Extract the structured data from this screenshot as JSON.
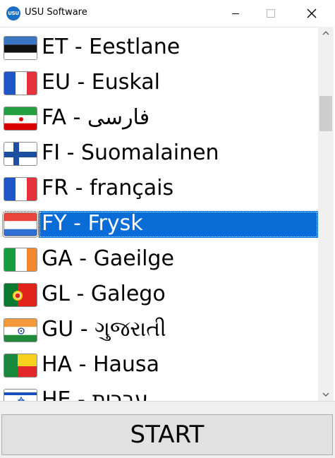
{
  "window": {
    "title": "USU Software",
    "app_icon_text": "USU"
  },
  "languages": [
    {
      "label": "ET - Eestlane",
      "flag": "estonia-flag"
    },
    {
      "label": "EU - Euskal",
      "flag": "france-flag"
    },
    {
      "label": "FA - فارسی",
      "flag": "iran-flag"
    },
    {
      "label": "FI - Suomalainen",
      "flag": "finland-flag"
    },
    {
      "label": "FR - français",
      "flag": "france-flag"
    },
    {
      "label": "FY - Frysk",
      "flag": "netherlands-flag",
      "selected": true
    },
    {
      "label": "GA - Gaeilge",
      "flag": "ireland-flag"
    },
    {
      "label": "GL - Galego",
      "flag": "portugal-flag"
    },
    {
      "label": "GU - ગુજરાતી",
      "flag": "india-flag"
    },
    {
      "label": "HA - Hausa",
      "flag": "benin-flag"
    },
    {
      "label": "HE - עברית",
      "flag": "israel-flag"
    }
  ],
  "start_button": {
    "label": "START"
  },
  "colors": {
    "selection": "#0a6cd6"
  }
}
